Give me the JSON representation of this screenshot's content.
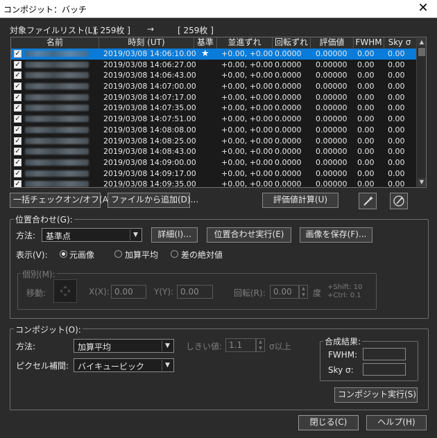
{
  "window": {
    "title": "コンポジット：バッチ",
    "close_glyph": "✕"
  },
  "filelist": {
    "label": "対象ファイルリスト(L):",
    "count_from": "[ 259枚 ]",
    "arrow": "→",
    "count_to": "[ 259枚 ]"
  },
  "table": {
    "headers": [
      "名前",
      "時刻 (UT)",
      "基準",
      "並進ずれ",
      "回転ずれ",
      "評価値",
      "FWHM",
      "Sky σ"
    ],
    "rows": [
      {
        "time": "2019/03/08 14:06:10.00",
        "ref": "★",
        "shift": "+0.00, +0.00",
        "rot": "0.0000",
        "eval": "0.00000",
        "fwhm": "0.00",
        "sky": "0.00",
        "selected": true
      },
      {
        "time": "2019/03/08 14:06:27.00",
        "ref": "",
        "shift": "+0.00, +0.00",
        "rot": "0.0000",
        "eval": "0.00000",
        "fwhm": "0.00",
        "sky": "0.00"
      },
      {
        "time": "2019/03/08 14:06:43.00",
        "ref": "",
        "shift": "+0.00, +0.00",
        "rot": "0.0000",
        "eval": "0.00000",
        "fwhm": "0.00",
        "sky": "0.00"
      },
      {
        "time": "2019/03/08 14:07:00.00",
        "ref": "",
        "shift": "+0.00, +0.00",
        "rot": "0.0000",
        "eval": "0.00000",
        "fwhm": "0.00",
        "sky": "0.00"
      },
      {
        "time": "2019/03/08 14:07:17.00",
        "ref": "",
        "shift": "+0.00, +0.00",
        "rot": "0.0000",
        "eval": "0.00000",
        "fwhm": "0.00",
        "sky": "0.00"
      },
      {
        "time": "2019/03/08 14:07:35.00",
        "ref": "",
        "shift": "+0.00, +0.00",
        "rot": "0.0000",
        "eval": "0.00000",
        "fwhm": "0.00",
        "sky": "0.00"
      },
      {
        "time": "2019/03/08 14:07:51.00",
        "ref": "",
        "shift": "+0.00, +0.00",
        "rot": "0.0000",
        "eval": "0.00000",
        "fwhm": "0.00",
        "sky": "0.00"
      },
      {
        "time": "2019/03/08 14:08:08.00",
        "ref": "",
        "shift": "+0.00, +0.00",
        "rot": "0.0000",
        "eval": "0.00000",
        "fwhm": "0.00",
        "sky": "0.00"
      },
      {
        "time": "2019/03/08 14:08:25.00",
        "ref": "",
        "shift": "+0.00, +0.00",
        "rot": "0.0000",
        "eval": "0.00000",
        "fwhm": "0.00",
        "sky": "0.00"
      },
      {
        "time": "2019/03/08 14:08:43.00",
        "ref": "",
        "shift": "+0.00, +0.00",
        "rot": "0.0000",
        "eval": "0.00000",
        "fwhm": "0.00",
        "sky": "0.00"
      },
      {
        "time": "2019/03/08 14:09:00.00",
        "ref": "",
        "shift": "+0.00, +0.00",
        "rot": "0.0000",
        "eval": "0.00000",
        "fwhm": "0.00",
        "sky": "0.00"
      },
      {
        "time": "2019/03/08 14:09:17.00",
        "ref": "",
        "shift": "+0.00, +0.00",
        "rot": "0.0000",
        "eval": "0.00000",
        "fwhm": "0.00",
        "sky": "0.00"
      },
      {
        "time": "2019/03/08 14:09:35.00",
        "ref": "",
        "shift": "+0.00, +0.00",
        "rot": "0.0000",
        "eval": "0.00000",
        "fwhm": "0.00",
        "sky": "0.00"
      }
    ]
  },
  "buttons": {
    "check_toggle": "一括チェックオン/オフ(A)",
    "add_from_file": "ファイルから追加(D)...",
    "evaluate": "評価値計算(U)",
    "wand1_icon": "magic-wand-icon",
    "wand2_icon": "magic-wand-circle-icon"
  },
  "alignment": {
    "legend": "位置合わせ(G):",
    "method_label": "方法:",
    "method_value": "基準点",
    "detail_button": "詳細(I)...",
    "run_button": "位置合わせ実行(E)",
    "save_button": "画像を保存(F)...",
    "display_label": "表示(V):",
    "display_options": [
      "元画像",
      "加算平均",
      "差の絶対値"
    ],
    "display_selected": 0,
    "individual": {
      "legend": "個別(M):",
      "move_label": "移動:",
      "x_label": "X(X):",
      "x_value": "0.00",
      "y_label": "Y(Y):",
      "y_value": "0.00",
      "rotate_label": "回転(R):",
      "rotate_value": "0.00",
      "rotate_unit": "度",
      "hint_shift": "+Shift: 10",
      "hint_ctrl": "+Ctrl: 0.1"
    }
  },
  "composite": {
    "legend": "コンポジット(O):",
    "method_label": "方法:",
    "method_value": "加算平均",
    "threshold_label": "しきい値:",
    "threshold_value": "1.1",
    "threshold_unit": "σ以上",
    "interp_label": "ピクセル補間:",
    "interp_value": "バイキュービック",
    "result": {
      "legend": "合成結果:",
      "fwhm_label": "FWHM:",
      "fwhm_value": "",
      "sky_label": "Sky σ:",
      "sky_value": ""
    },
    "run_button": "コンポジット実行(S)"
  },
  "footer": {
    "close_button": "閉じる(C)",
    "help_button": "ヘルプ(H)"
  }
}
